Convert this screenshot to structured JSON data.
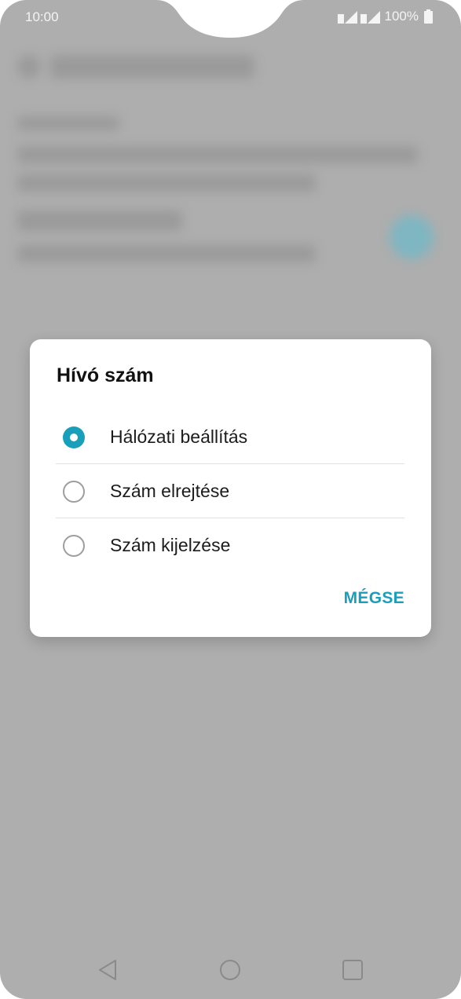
{
  "status_bar": {
    "time": "10:00",
    "battery_percent": "100%",
    "icons": [
      "sim1-signal-icon",
      "sim2-signal-icon",
      "battery-icon"
    ]
  },
  "dialog": {
    "title": "Hívó szám",
    "options": [
      {
        "label": "Hálózati beállítás",
        "selected": true
      },
      {
        "label": "Szám elrejtése",
        "selected": false
      },
      {
        "label": "Szám kijelzése",
        "selected": false
      }
    ],
    "cancel_label": "MÉGSE"
  },
  "navigation": {
    "buttons": [
      "back-icon",
      "home-icon",
      "recents-icon"
    ]
  },
  "colors": {
    "accent": "#1a9fba",
    "scrim": "#aeaeae",
    "dialog_bg": "#ffffff"
  }
}
